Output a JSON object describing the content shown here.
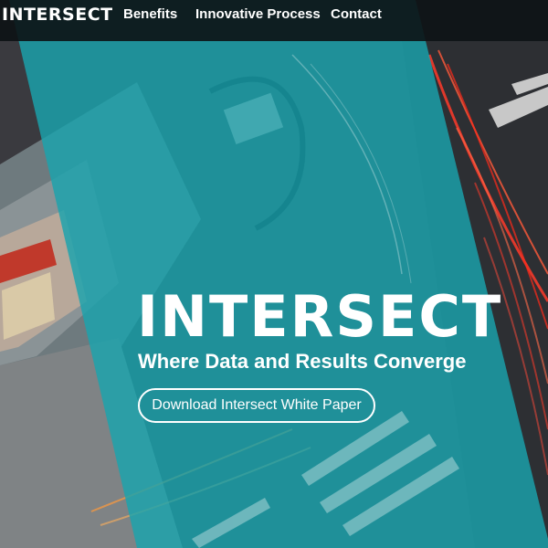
{
  "nav": {
    "logo": "INTERSECT",
    "links": [
      {
        "label": "Benefits"
      },
      {
        "label": "Innovative Process"
      },
      {
        "label": "Contact"
      }
    ]
  },
  "hero": {
    "logo": "INTERSECT",
    "tagline": "Where Data and Results Converge",
    "cta_label": "Download Intersect White Paper"
  },
  "colors": {
    "overlay": "#1aa3ad",
    "navbar": "#0c1214",
    "text": "#ffffff",
    "light_trails": "#ff3a2a"
  }
}
